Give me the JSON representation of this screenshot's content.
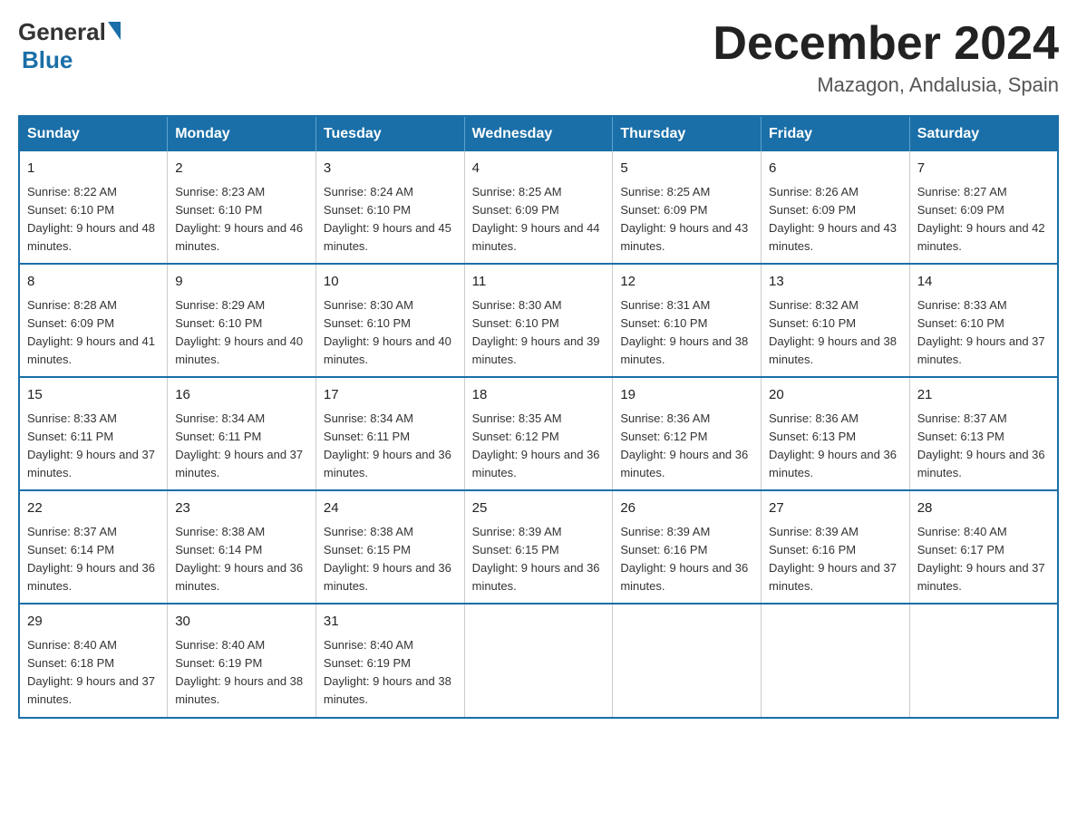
{
  "logo": {
    "general": "General",
    "blue": "Blue"
  },
  "title": {
    "month": "December 2024",
    "location": "Mazagon, Andalusia, Spain"
  },
  "weekdays": [
    "Sunday",
    "Monday",
    "Tuesday",
    "Wednesday",
    "Thursday",
    "Friday",
    "Saturday"
  ],
  "weeks": [
    [
      {
        "day": "1",
        "sunrise": "8:22 AM",
        "sunset": "6:10 PM",
        "daylight": "9 hours and 48 minutes."
      },
      {
        "day": "2",
        "sunrise": "8:23 AM",
        "sunset": "6:10 PM",
        "daylight": "9 hours and 46 minutes."
      },
      {
        "day": "3",
        "sunrise": "8:24 AM",
        "sunset": "6:10 PM",
        "daylight": "9 hours and 45 minutes."
      },
      {
        "day": "4",
        "sunrise": "8:25 AM",
        "sunset": "6:09 PM",
        "daylight": "9 hours and 44 minutes."
      },
      {
        "day": "5",
        "sunrise": "8:25 AM",
        "sunset": "6:09 PM",
        "daylight": "9 hours and 43 minutes."
      },
      {
        "day": "6",
        "sunrise": "8:26 AM",
        "sunset": "6:09 PM",
        "daylight": "9 hours and 43 minutes."
      },
      {
        "day": "7",
        "sunrise": "8:27 AM",
        "sunset": "6:09 PM",
        "daylight": "9 hours and 42 minutes."
      }
    ],
    [
      {
        "day": "8",
        "sunrise": "8:28 AM",
        "sunset": "6:09 PM",
        "daylight": "9 hours and 41 minutes."
      },
      {
        "day": "9",
        "sunrise": "8:29 AM",
        "sunset": "6:10 PM",
        "daylight": "9 hours and 40 minutes."
      },
      {
        "day": "10",
        "sunrise": "8:30 AM",
        "sunset": "6:10 PM",
        "daylight": "9 hours and 40 minutes."
      },
      {
        "day": "11",
        "sunrise": "8:30 AM",
        "sunset": "6:10 PM",
        "daylight": "9 hours and 39 minutes."
      },
      {
        "day": "12",
        "sunrise": "8:31 AM",
        "sunset": "6:10 PM",
        "daylight": "9 hours and 38 minutes."
      },
      {
        "day": "13",
        "sunrise": "8:32 AM",
        "sunset": "6:10 PM",
        "daylight": "9 hours and 38 minutes."
      },
      {
        "day": "14",
        "sunrise": "8:33 AM",
        "sunset": "6:10 PM",
        "daylight": "9 hours and 37 minutes."
      }
    ],
    [
      {
        "day": "15",
        "sunrise": "8:33 AM",
        "sunset": "6:11 PM",
        "daylight": "9 hours and 37 minutes."
      },
      {
        "day": "16",
        "sunrise": "8:34 AM",
        "sunset": "6:11 PM",
        "daylight": "9 hours and 37 minutes."
      },
      {
        "day": "17",
        "sunrise": "8:34 AM",
        "sunset": "6:11 PM",
        "daylight": "9 hours and 36 minutes."
      },
      {
        "day": "18",
        "sunrise": "8:35 AM",
        "sunset": "6:12 PM",
        "daylight": "9 hours and 36 minutes."
      },
      {
        "day": "19",
        "sunrise": "8:36 AM",
        "sunset": "6:12 PM",
        "daylight": "9 hours and 36 minutes."
      },
      {
        "day": "20",
        "sunrise": "8:36 AM",
        "sunset": "6:13 PM",
        "daylight": "9 hours and 36 minutes."
      },
      {
        "day": "21",
        "sunrise": "8:37 AM",
        "sunset": "6:13 PM",
        "daylight": "9 hours and 36 minutes."
      }
    ],
    [
      {
        "day": "22",
        "sunrise": "8:37 AM",
        "sunset": "6:14 PM",
        "daylight": "9 hours and 36 minutes."
      },
      {
        "day": "23",
        "sunrise": "8:38 AM",
        "sunset": "6:14 PM",
        "daylight": "9 hours and 36 minutes."
      },
      {
        "day": "24",
        "sunrise": "8:38 AM",
        "sunset": "6:15 PM",
        "daylight": "9 hours and 36 minutes."
      },
      {
        "day": "25",
        "sunrise": "8:39 AM",
        "sunset": "6:15 PM",
        "daylight": "9 hours and 36 minutes."
      },
      {
        "day": "26",
        "sunrise": "8:39 AM",
        "sunset": "6:16 PM",
        "daylight": "9 hours and 36 minutes."
      },
      {
        "day": "27",
        "sunrise": "8:39 AM",
        "sunset": "6:16 PM",
        "daylight": "9 hours and 37 minutes."
      },
      {
        "day": "28",
        "sunrise": "8:40 AM",
        "sunset": "6:17 PM",
        "daylight": "9 hours and 37 minutes."
      }
    ],
    [
      {
        "day": "29",
        "sunrise": "8:40 AM",
        "sunset": "6:18 PM",
        "daylight": "9 hours and 37 minutes."
      },
      {
        "day": "30",
        "sunrise": "8:40 AM",
        "sunset": "6:19 PM",
        "daylight": "9 hours and 38 minutes."
      },
      {
        "day": "31",
        "sunrise": "8:40 AM",
        "sunset": "6:19 PM",
        "daylight": "9 hours and 38 minutes."
      },
      null,
      null,
      null,
      null
    ]
  ]
}
